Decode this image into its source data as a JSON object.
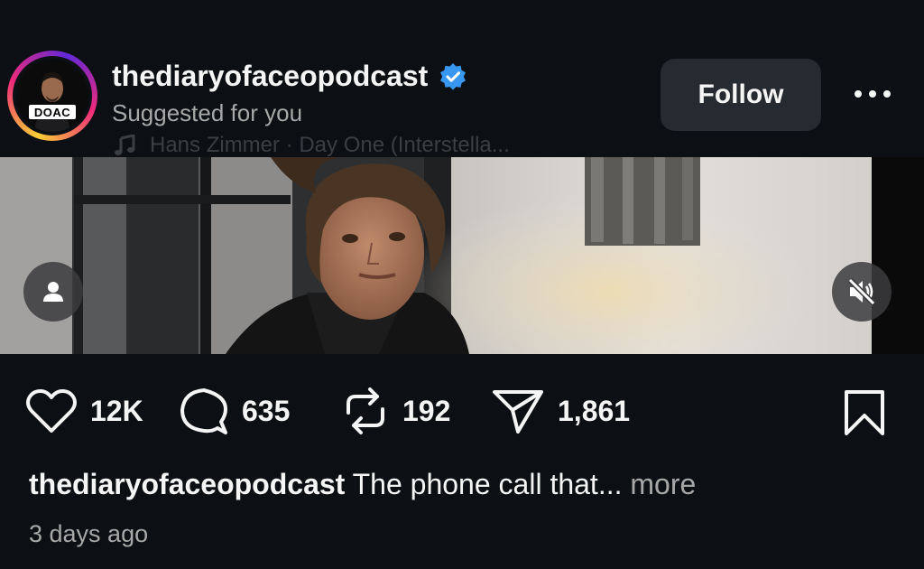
{
  "header": {
    "username": "thediaryofaceopodcast",
    "subtitle": "Suggested for you",
    "music": "Hans Zimmer · Day One (Interstella...",
    "follow_label": "Follow",
    "avatar_badge": "DOAC",
    "verified": true,
    "more_icon": "ellipsis-icon"
  },
  "media": {
    "user_tag_icon": "person-icon",
    "mute_icon": "speaker-muted-icon"
  },
  "actions": {
    "likes": "12K",
    "comments": "635",
    "reposts": "192",
    "shares": "1,861"
  },
  "caption": {
    "username": "thediaryofaceopodcast",
    "text": "The phone call that...",
    "more": "more"
  },
  "timestamp": "3 days ago",
  "colors": {
    "background": "#0c1014",
    "follow_button": "#262b31",
    "verified_blue": "#3897f0",
    "secondary_text": "#a8a8a8"
  }
}
